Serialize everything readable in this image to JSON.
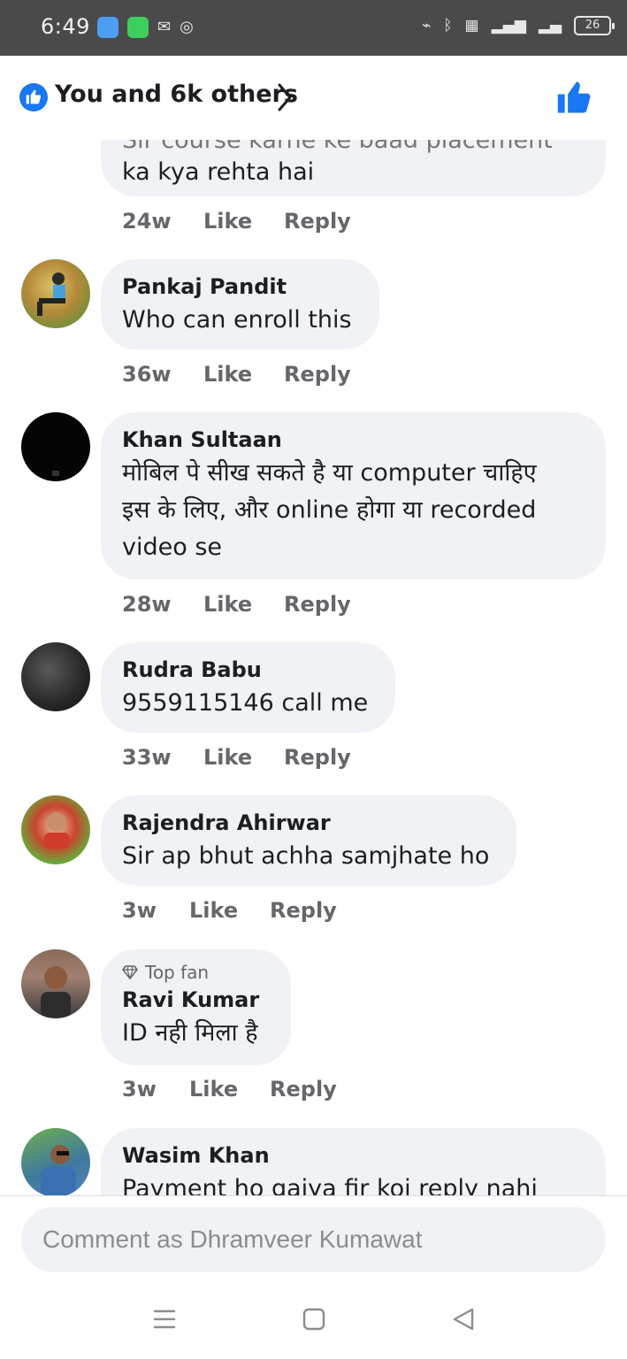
{
  "status_bar": {
    "time": "6:49",
    "battery": "26"
  },
  "reactions": {
    "summary": "You and 6k others"
  },
  "comments": [
    {
      "author": "",
      "text_partial": "Sir course karne ke baad placement",
      "text": "ka kya rehta hai",
      "time": "24w",
      "like": "Like",
      "reply": "Reply"
    },
    {
      "author": "Pankaj Pandit",
      "text": "Who can enroll this",
      "time": "36w",
      "like": "Like",
      "reply": "Reply"
    },
    {
      "author": "Khan Sultaan",
      "text_lines": [
        "मोबिल पे सीख सकते है या computer चाहिए",
        "इस के लिए, और online होगा या recorded",
        "video se"
      ],
      "time": "28w",
      "like": "Like",
      "reply": "Reply"
    },
    {
      "author": "Rudra Babu",
      "text": "9559115146 call me",
      "time": "33w",
      "like": "Like",
      "reply": "Reply"
    },
    {
      "author": "Rajendra Ahirwar",
      "text": "Sir ap bhut achha samjhate ho",
      "time": "3w",
      "like": "Like",
      "reply": "Reply"
    },
    {
      "badge": "Top fan",
      "author": "Ravi Kumar",
      "text": "ID नही मिला है",
      "time": "3w",
      "like": "Like",
      "reply": "Reply"
    },
    {
      "author": "Wasim Khan",
      "text": "Payment ho gaiya fir koi reply nahi"
    }
  ],
  "composer": {
    "placeholder": "Comment as Dhramveer Kumawat"
  },
  "colors": {
    "accent": "#1877f2",
    "bubble": "#f0f2f5",
    "secondary_text": "#65676b"
  }
}
